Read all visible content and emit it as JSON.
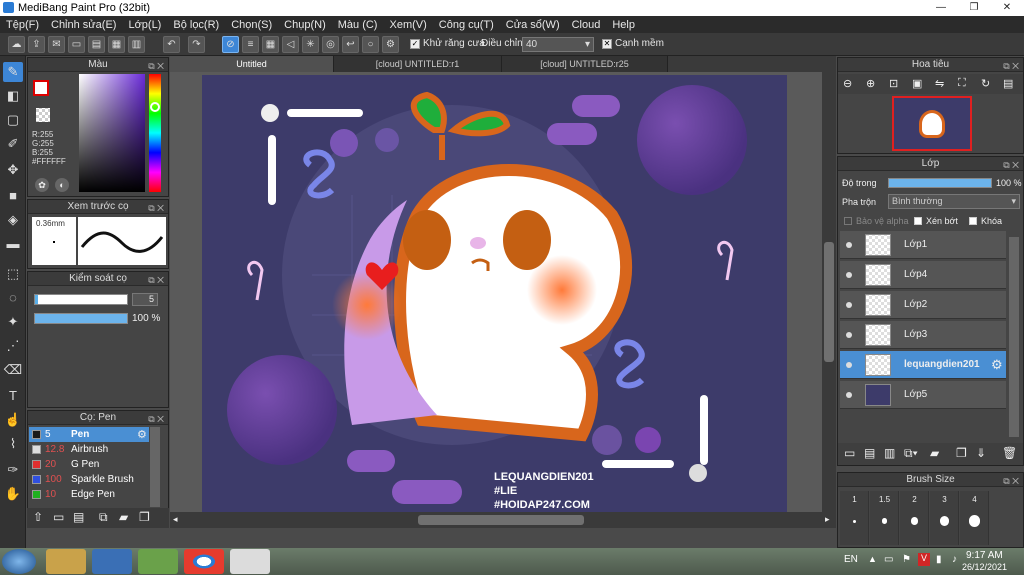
{
  "window": {
    "title": "MediBang Paint Pro (32bit)"
  },
  "menu": [
    "Tệp(F)",
    "Chỉnh sửa(E)",
    "Lớp(L)",
    "Bộ lọc(R)",
    "Chọn(S)",
    "Chụp(N)",
    "Màu (C)",
    "Xem(V)",
    "Công cụ(T)",
    "Cửa sổ(W)",
    "Cloud",
    "Help"
  ],
  "toolbar": {
    "antialias_label": "Khử răng cưa",
    "adjust_label": "Điều chỉnh",
    "adjust_value": "40",
    "sharp_label": "Cạnh mềm"
  },
  "color_panel": {
    "title": "Màu",
    "r": "R:255",
    "g": "G:255",
    "b": "B:255",
    "hex": "#FFFFFF"
  },
  "preview_panel": {
    "title": "Xem trước cọ",
    "size": "0.36mm"
  },
  "brush_control": {
    "title": "Kiểm soát cọ",
    "size_value": "5",
    "opacity_value": "100 %",
    "opacity_level": 1.0
  },
  "brush_list": {
    "title": "Cọ: Pen",
    "items": [
      {
        "size": "5",
        "name": "Pen",
        "color": "#1a1a1a",
        "selected": true
      },
      {
        "size": "12.8",
        "name": "Airbrush",
        "color": "#dddddd",
        "selected": false
      },
      {
        "size": "20",
        "name": "G Pen",
        "color": "#e03030",
        "selected": false
      },
      {
        "size": "100",
        "name": "Sparkle Brush",
        "color": "#3050e0",
        "selected": false
      },
      {
        "size": "10",
        "name": "Edge Pen",
        "color": "#20b020",
        "selected": false
      }
    ]
  },
  "tabs": [
    "Untitled",
    "[cloud] UNTITLED:r1",
    "[cloud] UNTITLED:r25"
  ],
  "artwork": {
    "text": [
      "LEQUANGDIEN201",
      "#LIE",
      "#HOIDAP247.COM"
    ]
  },
  "navigator": {
    "title": "Hoa tiêu"
  },
  "layer_panel": {
    "title": "Lớp",
    "opacity_label": "Độ trong",
    "opacity_value": "100 %",
    "opacity_level": 1.0,
    "blend_label": "Pha trộn",
    "blend_value": "Bình thường",
    "protect_alpha": "Bảo vệ alpha",
    "clipping": "Xén bớt",
    "lock": "Khóa",
    "layers": [
      {
        "name": "Lớp1",
        "selected": false
      },
      {
        "name": "Lớp4",
        "selected": false
      },
      {
        "name": "Lớp2",
        "selected": false
      },
      {
        "name": "Lớp3",
        "selected": false
      },
      {
        "name": "lequangdien201",
        "selected": true
      },
      {
        "name": "Lớp5",
        "selected": false
      }
    ]
  },
  "brush_size_panel": {
    "title": "Brush Size",
    "sizes": [
      "1",
      "1.5",
      "2",
      "3",
      "4"
    ]
  },
  "taskbar": {
    "lang": "EN",
    "time": "9:17 AM",
    "date": "26/12/2021"
  }
}
